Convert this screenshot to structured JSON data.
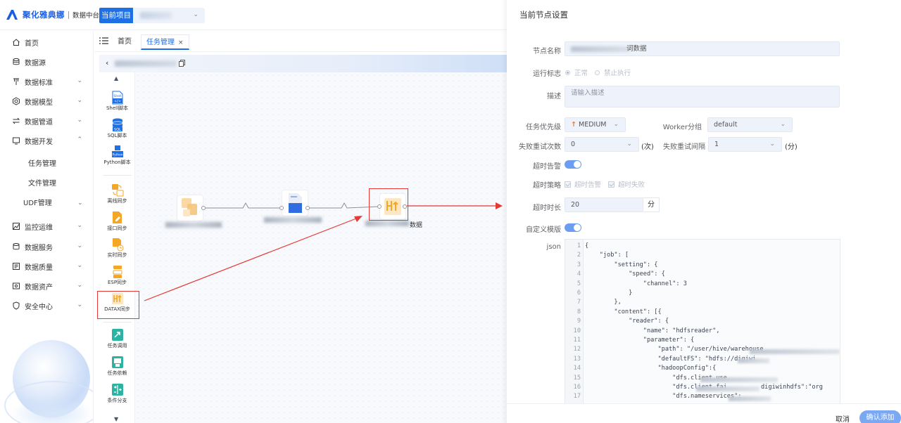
{
  "header": {
    "brand": "聚化雅典娜",
    "subtitle": "数据中台",
    "current_project_label": "当前项目"
  },
  "sidebar": {
    "items": [
      {
        "label": "首页",
        "icon": "home-icon"
      },
      {
        "label": "数据源",
        "icon": "database-icon"
      },
      {
        "label": "数据标准",
        "icon": "standard-icon"
      },
      {
        "label": "数据模型",
        "icon": "model-icon"
      },
      {
        "label": "数据管道",
        "icon": "pipeline-icon"
      },
      {
        "label": "数据开发",
        "icon": "monitor-icon"
      },
      {
        "label": "监控运维",
        "icon": "ops-icon"
      },
      {
        "label": "数据服务",
        "icon": "service-icon"
      },
      {
        "label": "数据质量",
        "icon": "quality-icon"
      },
      {
        "label": "数据资产",
        "icon": "asset-icon"
      },
      {
        "label": "安全中心",
        "icon": "shield-icon"
      }
    ],
    "sub_items": [
      "任务管理",
      "文件管理",
      "UDF管理"
    ]
  },
  "tabs": {
    "home": "首页",
    "active": "任务管理",
    "close": "×"
  },
  "palette": {
    "items": [
      {
        "label": "Shell脚本",
        "icon": "shell-script-icon"
      },
      {
        "label": "SQL脚本",
        "icon": "sql-script-icon"
      },
      {
        "label": "Python脚本",
        "icon": "python-script-icon"
      },
      {
        "label": "离线同步",
        "icon": "offline-sync-icon"
      },
      {
        "label": "接口同步",
        "icon": "api-sync-icon"
      },
      {
        "label": "实时同步",
        "icon": "realtime-sync-icon"
      },
      {
        "label": "ESP同步",
        "icon": "esp-sync-icon"
      },
      {
        "label": "DATAX同步",
        "icon": "datax-sync-icon"
      },
      {
        "label": "任务调用",
        "icon": "task-call-icon"
      },
      {
        "label": "任务依赖",
        "icon": "task-dependency-icon"
      },
      {
        "label": "条件分支",
        "icon": "branch-icon"
      }
    ],
    "shell_badge": "Shell",
    "sql_badge": "SQL",
    "python_badge": "Python"
  },
  "flow": {
    "node3_label_suffix": "数据"
  },
  "panel": {
    "title": "当前节点设置",
    "node_name_label": "节点名称",
    "node_name_value_suffix": "词数据",
    "run_flag_label": "运行标志",
    "run_normal": "正常",
    "run_disabled": "禁止执行",
    "desc_label": "描述",
    "desc_placeholder": "请输入描述",
    "priority_label": "任务优先级",
    "priority_value": "MEDIUM",
    "worker_label": "Worker分组",
    "worker_value": "default",
    "retry_label": "失败重试次数",
    "retry_value": "0",
    "retry_unit": "(次)",
    "retry_interval_label": "失败重试间隔",
    "retry_interval_value": "1",
    "retry_interval_unit": "(分)",
    "timeout_alarm_label": "超时告警",
    "timeout_strategy_label": "超时策略",
    "strategy_alarm": "超时告警",
    "strategy_fail": "超时失败",
    "timeout_duration_label": "超时时长",
    "timeout_duration_value": "20",
    "timeout_unit": "分",
    "custom_template_label": "自定义模版",
    "json_label": "json",
    "cancel": "取消",
    "confirm": "确认添加"
  },
  "code_lines": [
    {
      "n": "1",
      "t": "{"
    },
    {
      "n": "2",
      "t": "    \"job\": ["
    },
    {
      "n": "3",
      "t": "        \"setting\": {"
    },
    {
      "n": "4",
      "t": "            \"speed\": {"
    },
    {
      "n": "5",
      "t": "                \"channel\": 3"
    },
    {
      "n": "6",
      "t": "            }"
    },
    {
      "n": "7",
      "t": "        },"
    },
    {
      "n": "8",
      "t": "        \"content\": [{"
    },
    {
      "n": "9",
      "t": "            \"reader\": {"
    },
    {
      "n": "10",
      "t": "                \"name\": \"hdfsreader\","
    },
    {
      "n": "11",
      "t": "                \"parameter\": {"
    },
    {
      "n": "12",
      "t": "                    \"path\": \"/user/hive/warehouse"
    },
    {
      "n": "13",
      "t": "                    \"defaultFS\": \"hdfs://digiwi"
    },
    {
      "n": "14",
      "t": "                    \"hadoopConfig\":{"
    },
    {
      "n": "15",
      "t": "                        \"dfs.client.use."
    },
    {
      "n": "16",
      "t": "                        \"dfs.client.fai"
    },
    {
      "n": "17",
      "t": "                        \"dfs.nameservices\": "
    }
  ],
  "code_tail": {
    "l16_tail": "digiwinhdfs\":\"org"
  },
  "colors": {
    "primary": "#1f6fe5",
    "highlight_red": "#e53935",
    "switch_on": "#6b9df0"
  }
}
